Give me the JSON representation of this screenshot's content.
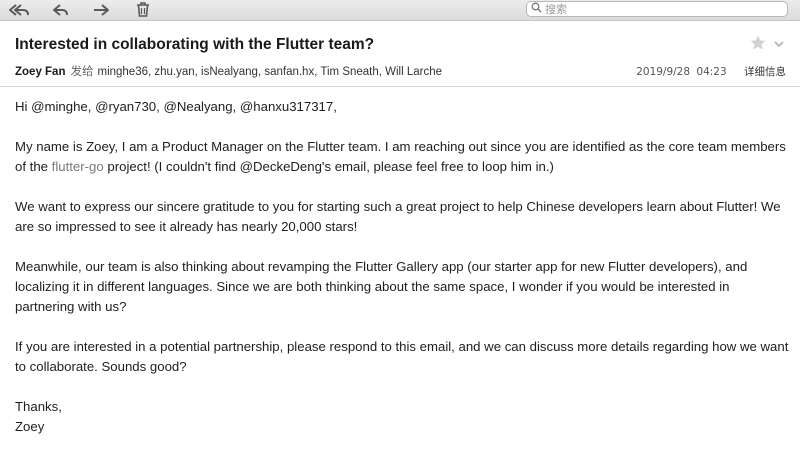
{
  "toolbar": {
    "buttons": [
      {
        "name": "reply-all-icon"
      },
      {
        "name": "reply-icon"
      },
      {
        "name": "forward-icon"
      },
      {
        "name": "trash-icon"
      }
    ],
    "search_placeholder": "搜索"
  },
  "email": {
    "subject": "Interested in collaborating with the Flutter team?",
    "from": "Zoey Fan",
    "sent_to_label": "发给",
    "recipients": "minghe36, zhu.yan, isNealyang, sanfan.hx, Tim Sneath, Will Larche",
    "date": "2019/9/28",
    "time": "04:23",
    "details_label": "详细信息",
    "greeting": "Hi @minghe, @ryan730, @Nealyang, @hanxu317317,",
    "p1_a": "My name is Zoey, I am a Product Manager on the Flutter team. I am reaching out since you are identified as the core team members of the ",
    "p1_link": "flutter-go",
    "p1_b": " project! (I couldn't find @DeckeDeng's email, please feel free to loop him in.)",
    "p2": "We want to express our sincere gratitude to you for starting such a great project to help Chinese developers learn about Flutter! We are so impressed to see it already has nearly 20,000 stars!",
    "p3": "Meanwhile, our team is also thinking about revamping the Flutter Gallery app (our starter app for new Flutter developers), and localizing it in different languages. Since we are both thinking about the same space, I wonder if you would be interested in partnering with us?",
    "p4": "If you are interested in a potential partnership, please respond to this email, and we can discuss more details regarding how we want to collaborate. Sounds good?",
    "closing": "Thanks,",
    "signature": "Zoey"
  },
  "colors": {
    "toolbar_bg": "#e4e4e4",
    "link": "#7a7a7a",
    "icon": "#5a5a5a",
    "star": "#d0d0d0"
  }
}
